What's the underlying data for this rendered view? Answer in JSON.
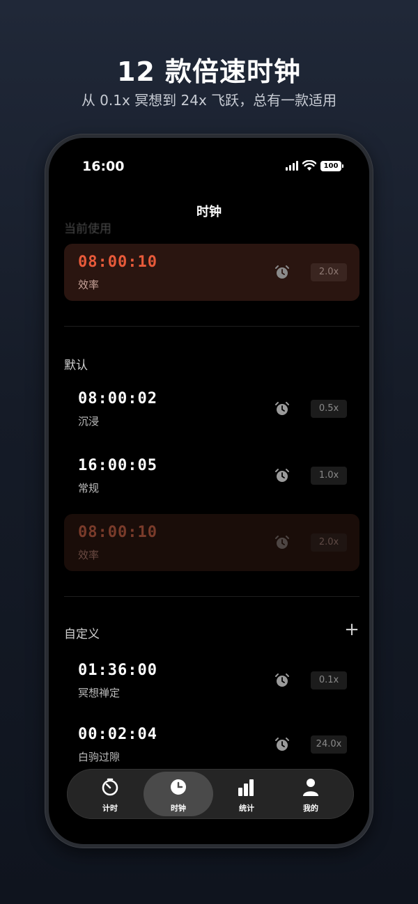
{
  "headline": "12 款倍速时钟",
  "subline": "从 0.1x 冥想到 24x 飞跃，总有一款适用",
  "status": {
    "time": "16:00",
    "battery": "100"
  },
  "nav": {
    "title": "时钟"
  },
  "current": {
    "section_label": "当前使用",
    "row": {
      "time": "08:00:10",
      "name": "效率",
      "speed": "2.0x"
    }
  },
  "default_section": {
    "label": "默认",
    "rows": [
      {
        "time": "08:00:02",
        "name": "沉浸",
        "speed": "0.5x"
      },
      {
        "time": "16:00:05",
        "name": "常规",
        "speed": "1.0x"
      },
      {
        "time": "08:00:10",
        "name": "效率",
        "speed": "2.0x"
      }
    ]
  },
  "custom_section": {
    "label": "自定义",
    "add_label": "+",
    "rows": [
      {
        "time": "01:36:00",
        "name": "冥想禅定",
        "speed": "0.1x"
      },
      {
        "time": "00:02:04",
        "name": "白驹过隙",
        "speed": "24.0x"
      }
    ]
  },
  "tabbar": {
    "tabs": [
      {
        "label": "计时",
        "icon": "stopwatch-icon"
      },
      {
        "label": "时钟",
        "icon": "clock-icon",
        "selected": true
      },
      {
        "label": "统计",
        "icon": "bar-chart-icon"
      },
      {
        "label": "我的",
        "icon": "person-icon"
      }
    ]
  },
  "colors": {
    "accent": "#e85a3a",
    "active_bg": "#2a1510",
    "screen_bg": "#000000"
  }
}
